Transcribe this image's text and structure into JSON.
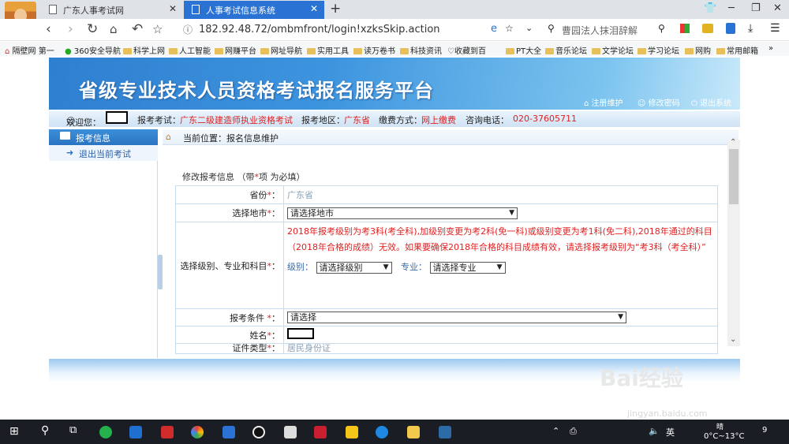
{
  "browser": {
    "tabs": [
      {
        "label": "广东人事考试网"
      },
      {
        "label": "人事考试信息系统"
      }
    ],
    "url": "182.92.48.72/ombmfront/login!xzksSkip.action",
    "search_text": "曹园法人抹泪辞解",
    "bookmarks": [
      "隔壁网 第一",
      "360安全导航",
      "科学上网",
      "人工智能",
      "网赚平台",
      "网址导航",
      "实用工具",
      "读万卷书",
      "科技资讯",
      "收藏到百",
      "PT大全",
      "音乐论坛",
      "文学论坛",
      "学习论坛",
      "网购",
      "常用邮箱"
    ],
    "more": "»"
  },
  "site": {
    "title": "省级专业技术人员资格考试报名服务平台",
    "links": [
      "注册维护",
      "修改密码",
      "退出系统"
    ]
  },
  "info": {
    "welcome": "欢迎您：",
    "exam_label": "报考考试：",
    "exam_value": "广东二级建造师执业资格考试",
    "region_label": "报考地区：",
    "region_value": "广东省",
    "pay_label": "缴费方式：",
    "pay_value": "网上缴费",
    "phone_label": "咨询电话：",
    "phone_value": "020-37605711"
  },
  "sidebar": {
    "header": "报考信息",
    "item": "退出当前考试"
  },
  "breadcrumb": "当前位置：报名信息维护",
  "form": {
    "title_pre": "修改报考信息 （带",
    "title_star": "*",
    "title_post": "项 为必填）",
    "province_label": "省份",
    "province_value": "广东省",
    "city_label": "选择地市",
    "city_select": "请选择地市",
    "subject_label": "选择级别、专业和科目",
    "notice": "2018年报考级别为考3科(考全科),加级别变更为考2科(免一科)或级别变更为考1科(免二科),2018年通过的科目（2018年合格的成绩）无效。如果要确保2018年合格的科目成绩有效，请选择报考级别为“考3科（考全科）”",
    "level_label": "级别：",
    "level_select": "请选择级别",
    "major_label": "专业：",
    "major_select": "请选择专业",
    "condition_label": "报考条件 ",
    "condition_select": "请选择",
    "name_label": "姓名",
    "idtype_label": "证件类型",
    "idtype_value": "居民身份证",
    "star": "*",
    "colon": "："
  },
  "taskbar": {
    "ime": "英",
    "weather": "晴",
    "temp": "0°C~13°C",
    "notify": "9"
  },
  "watermark": {
    "logo": "Bai经验",
    "url": "jingyan.baidu.com"
  },
  "colors": {
    "accent": "#2a73d4",
    "required": "#e02020",
    "banner": "#3d94de"
  }
}
